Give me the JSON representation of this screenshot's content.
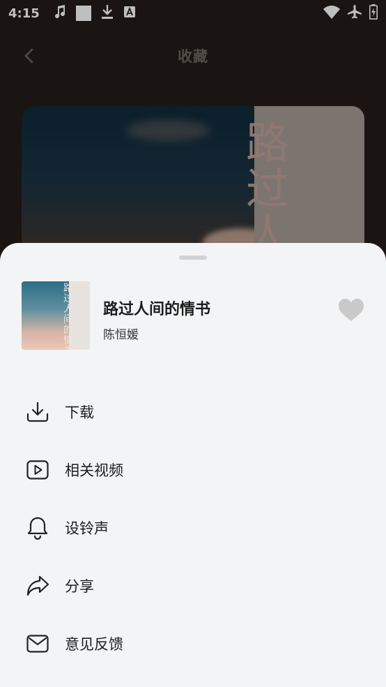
{
  "status": {
    "time": "4:15"
  },
  "nav": {
    "title": "收藏"
  },
  "hero": {
    "cover_text": "路过人"
  },
  "song": {
    "title": "路过人间的情书",
    "artist": "陈恒媛",
    "cover_text": "路过人间的情书"
  },
  "menu": {
    "items": [
      {
        "label": "下载",
        "icon": "download-icon"
      },
      {
        "label": "相关视频",
        "icon": "video-play-icon"
      },
      {
        "label": "设铃声",
        "icon": "bell-icon"
      },
      {
        "label": "分享",
        "icon": "share-icon"
      },
      {
        "label": "意见反馈",
        "icon": "mail-icon"
      }
    ]
  },
  "colors": {
    "background": "#231b18",
    "sheet": "#f3f4f5",
    "text_primary": "#1d1d1d",
    "heart": "#c9c9c9"
  }
}
